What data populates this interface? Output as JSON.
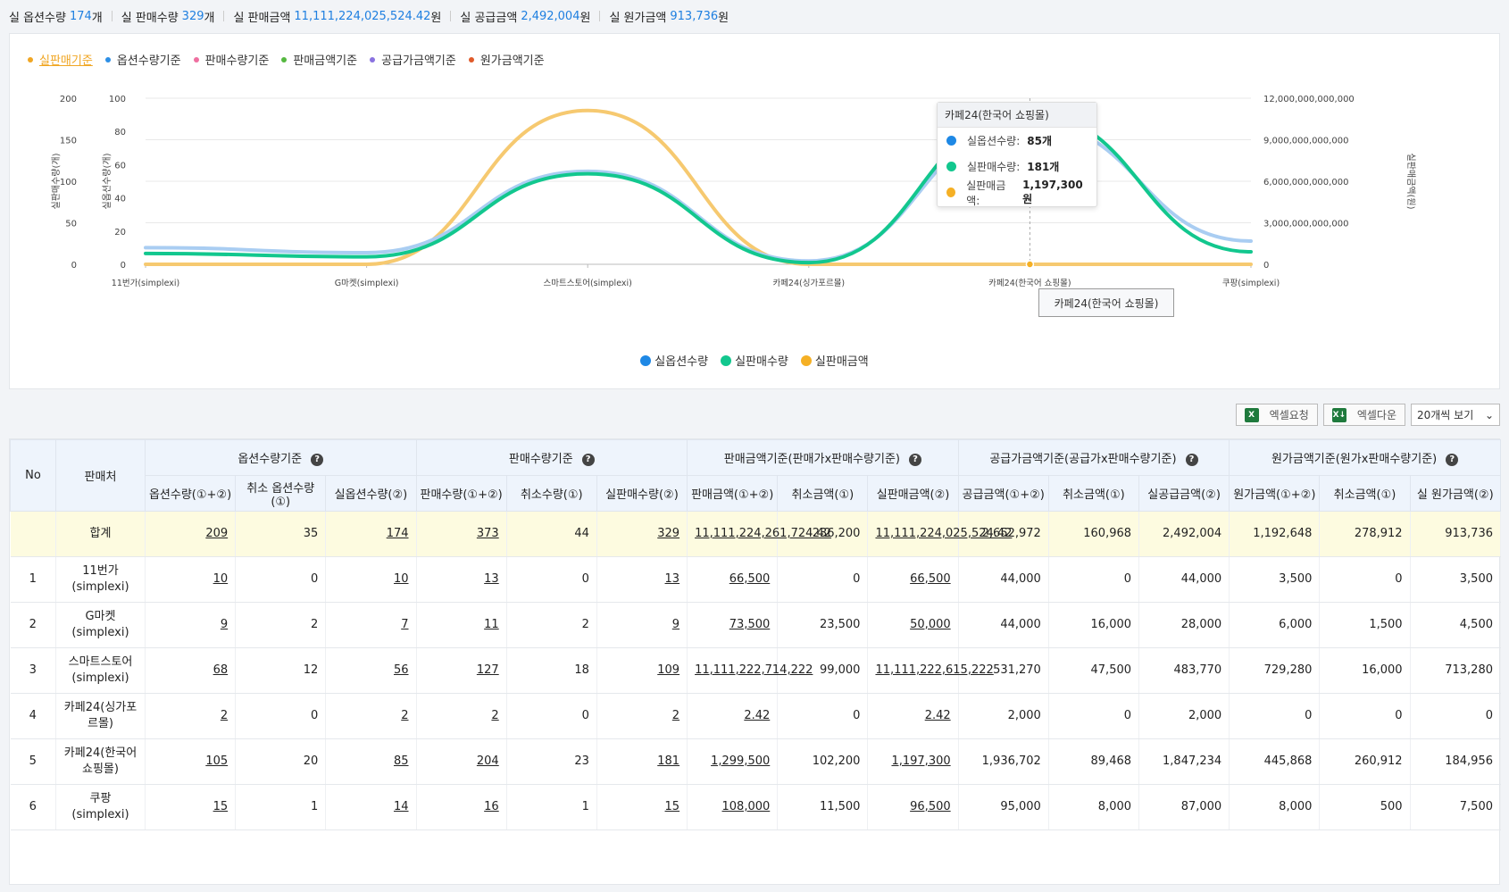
{
  "summary": [
    {
      "label": "실 옵션수량",
      "value": "174",
      "unit": "개"
    },
    {
      "label": "실 판매수량",
      "value": "329",
      "unit": "개"
    },
    {
      "label": "실 판매금액",
      "value": "11,111,224,025,524.42",
      "unit": "원"
    },
    {
      "label": "실 공급금액",
      "value": "2,492,004",
      "unit": "원"
    },
    {
      "label": "실 원가금액",
      "value": "913,736",
      "unit": "원"
    }
  ],
  "legend_top": [
    {
      "label": "실판매기준",
      "color": "#f0a623",
      "active": true
    },
    {
      "label": "옵션수량기준",
      "color": "#2d8fe6"
    },
    {
      "label": "판매수량기준",
      "color": "#ef6fa0"
    },
    {
      "label": "판매금액기준",
      "color": "#55b840"
    },
    {
      "label": "공급가금액기준",
      "color": "#8a72e0"
    },
    {
      "label": "원가금액기준",
      "color": "#e05a2a"
    }
  ],
  "chart_data": {
    "type": "line",
    "categories": [
      "11번가(simplexi)",
      "G마켓(simplexi)",
      "스마트스토어(simplexi)",
      "카페24(싱가포르몰)",
      "카페24(한국어 쇼핑몰)",
      "쿠팡(simplexi)"
    ],
    "series": [
      {
        "name": "실옵션수량",
        "color": "#a9cdf2",
        "values": [
          10,
          7,
          56,
          2,
          85,
          14
        ],
        "axis": "left1"
      },
      {
        "name": "실판매수량",
        "color": "#12c78e",
        "values": [
          13,
          9,
          109,
          2,
          181,
          15
        ],
        "axis": "left2"
      },
      {
        "name": "실판매금액",
        "color": "#f6c970",
        "values": [
          66500,
          50000,
          11111222615222,
          2.42,
          1197300,
          96500
        ],
        "axis": "right"
      }
    ],
    "left1_axis": {
      "label": "실옵션수량(개)",
      "ticks": [
        "0",
        "20",
        "40",
        "60",
        "80",
        "100"
      ],
      "ylim": [
        0,
        100
      ]
    },
    "left2_axis": {
      "label": "실판매수량(개)",
      "ticks": [
        "0",
        "50",
        "100",
        "150",
        "200"
      ],
      "ylim": [
        0,
        200
      ]
    },
    "right_axis": {
      "label": "실판매금액(원)",
      "ticks": [
        "0",
        "3,000,000,000,000",
        "6,000,000,000,000",
        "9,000,000,000,000",
        "12,000,000,000,000"
      ],
      "ylim": [
        0,
        12000000000000
      ]
    },
    "highlight_index": 4
  },
  "tooltip": {
    "title": "카페24(한국어 쇼핑몰)",
    "rows": [
      {
        "label": "실옵션수량:",
        "value": "85개",
        "color": "#1e88e5"
      },
      {
        "label": "실판매수량:",
        "value": "181개",
        "color": "#12c78e"
      },
      {
        "label": "실판매금액:",
        "value": "1,197,300원",
        "color": "#f5b025"
      }
    ]
  },
  "x_highlight_label": "카페24(한국어 쇼핑몰)",
  "legend_bottom": [
    {
      "label": "실옵션수량",
      "color": "#1e88e5"
    },
    {
      "label": "실판매수량",
      "color": "#12c78e"
    },
    {
      "label": "실판매금액",
      "color": "#f5b025"
    }
  ],
  "toolbar": {
    "excel_request": "엑셀요청",
    "excel_down": "엑셀다운",
    "page_size": "20개씩 보기"
  },
  "table": {
    "h_no": "No",
    "h_seller": "판매처",
    "groups": [
      "옵션수량기준",
      "판매수량기준",
      "판매금액기준(판매가x판매수량기준)",
      "공급가금액기준(공급가x판매수량기준)",
      "원가금액기준(원가x판매수량기준)"
    ],
    "sub": [
      "옵션수량(①+②)",
      "취소 옵션수량(①)",
      "실옵션수량(②)",
      "판매수량(①+②)",
      "취소수량(①)",
      "실판매수량(②)",
      "판매금액(①+②)",
      "취소금액(①)",
      "실판매금액(②)",
      "공급금액(①+②)",
      "취소금액(①)",
      "실공급금액(②)",
      "원가금액(①+②)",
      "취소금액(①)",
      "실 원가금액(②)"
    ],
    "total_label": "합계",
    "total": [
      "209",
      "35",
      "174",
      "373",
      "44",
      "329",
      "11,111,224,261,724.42",
      "236,200",
      "11,111,224,025,524.42",
      "2,652,972",
      "160,968",
      "2,492,004",
      "1,192,648",
      "278,912",
      "913,736"
    ],
    "rows": [
      {
        "no": "1",
        "seller": "11번가(simplexi)",
        "v": [
          "10",
          "0",
          "10",
          "13",
          "0",
          "13",
          "66,500",
          "0",
          "66,500",
          "44,000",
          "0",
          "44,000",
          "3,500",
          "0",
          "3,500"
        ]
      },
      {
        "no": "2",
        "seller": "G마켓(simplexi)",
        "v": [
          "9",
          "2",
          "7",
          "11",
          "2",
          "9",
          "73,500",
          "23,500",
          "50,000",
          "44,000",
          "16,000",
          "28,000",
          "6,000",
          "1,500",
          "4,500"
        ]
      },
      {
        "no": "3",
        "seller": "스마트스토어(simplexi)",
        "v": [
          "68",
          "12",
          "56",
          "127",
          "18",
          "109",
          "11,111,222,714,222",
          "99,000",
          "11,111,222,615,222",
          "531,270",
          "47,500",
          "483,770",
          "729,280",
          "16,000",
          "713,280"
        ]
      },
      {
        "no": "4",
        "seller": "카페24(싱가포르몰)",
        "v": [
          "2",
          "0",
          "2",
          "2",
          "0",
          "2",
          "2.42",
          "0",
          "2.42",
          "2,000",
          "0",
          "2,000",
          "0",
          "0",
          "0"
        ]
      },
      {
        "no": "5",
        "seller": "카페24(한국어 쇼핑몰)",
        "v": [
          "105",
          "20",
          "85",
          "204",
          "23",
          "181",
          "1,299,500",
          "102,200",
          "1,197,300",
          "1,936,702",
          "89,468",
          "1,847,234",
          "445,868",
          "260,912",
          "184,956"
        ]
      },
      {
        "no": "6",
        "seller": "쿠팡(simplexi)",
        "v": [
          "15",
          "1",
          "14",
          "16",
          "1",
          "15",
          "108,000",
          "11,500",
          "96,500",
          "95,000",
          "8,000",
          "87,000",
          "8,000",
          "500",
          "7,500"
        ]
      }
    ]
  }
}
